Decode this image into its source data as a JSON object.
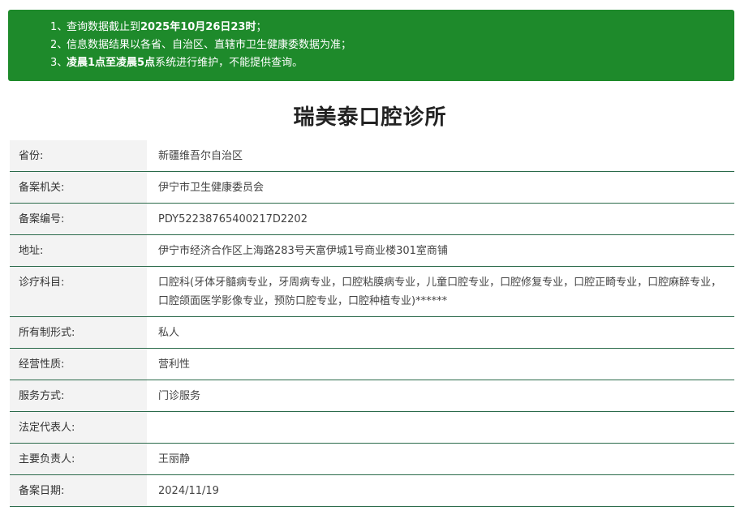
{
  "notice": {
    "lines": [
      {
        "num": "1、",
        "prefix": "查询数据截止到",
        "bold": "2025年10月26日23时",
        "suffix": "；"
      },
      {
        "num": "2、",
        "prefix": "信息数据结果以各省、自治区、直辖市卫生健康委数据为准；",
        "bold": "",
        "suffix": ""
      },
      {
        "num": "3、",
        "prefix": "",
        "bold": "凌晨1点至凌晨5点",
        "suffix": "系统进行维护，不能提供查询。"
      }
    ],
    "background_color": "#1e8a2b"
  },
  "title": "瑞美泰口腔诊所",
  "rows": [
    {
      "label": "省份:",
      "value": "新疆维吾尔自治区"
    },
    {
      "label": "备案机关:",
      "value": "伊宁市卫生健康委员会"
    },
    {
      "label": "备案编号:",
      "value": "PDY52238765400217D2202"
    },
    {
      "label": "地址:",
      "value": "伊宁市经济合作区上海路283号天富伊城1号商业楼301室商铺"
    },
    {
      "label": "诊疗科目:",
      "value": "口腔科(牙体牙髓病专业，牙周病专业，口腔粘膜病专业，儿童口腔专业，口腔修复专业，口腔正畸专业，口腔麻醉专业，口腔颌面医学影像专业，预防口腔专业，口腔种植专业)******"
    },
    {
      "label": "所有制形式:",
      "value": "私人"
    },
    {
      "label": "经营性质:",
      "value": "营利性"
    },
    {
      "label": "服务方式:",
      "value": "门诊服务"
    },
    {
      "label": "法定代表人:",
      "value": ""
    },
    {
      "label": "主要负责人:",
      "value": "王丽静"
    },
    {
      "label": "备案日期:",
      "value": "2024/11/19"
    }
  ]
}
